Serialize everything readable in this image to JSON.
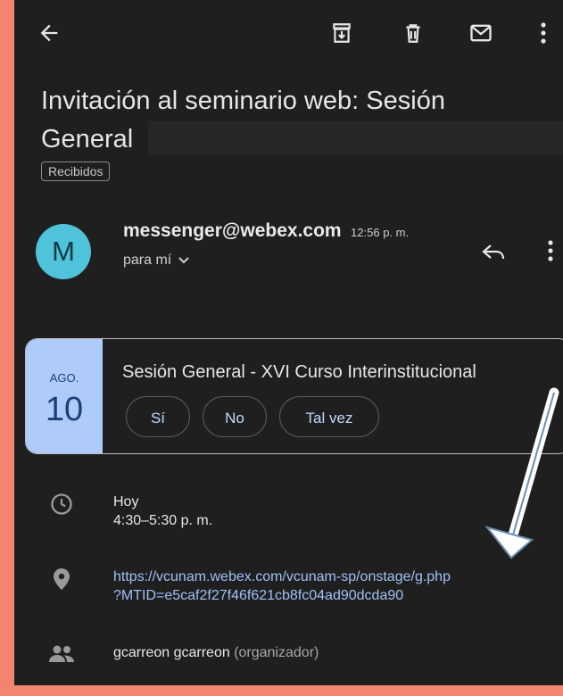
{
  "toolbar": {
    "back_icon": "arrow-left-icon",
    "archive_icon": "archive-icon",
    "delete_icon": "trash-icon",
    "unread_icon": "envelope-icon",
    "more_icon": "more-vertical-icon"
  },
  "email": {
    "subject_line1": "Invitación al seminario web: Sesión",
    "subject_line2": "General",
    "label": "Recibidos",
    "sender": {
      "avatar_letter": "M",
      "email": "messenger@webex.com",
      "time": "12:56 p. m.",
      "recipient": "para mí"
    }
  },
  "event": {
    "month": "AGO.",
    "day": "10",
    "title": "Sesión General - XVI Curso Interinstitucional",
    "rsvp": [
      "Sí",
      "No",
      "Tal vez"
    ],
    "when_label": "Hoy",
    "when_time": "4:30–5:30 p. m.",
    "location_line1": "https://vcunam.webex.com/vcunam-sp/onstage/g.php",
    "location_line2": "?MTID=e5caf2f27f46f621cb8fc04ad90dcda90",
    "organizer_name": "gcarreon gcarreon",
    "organizer_role": "(organizador)"
  },
  "colors": {
    "background": "#f4846f",
    "screen": "#1f1f1f",
    "avatar": "#4fc3d9",
    "date_block": "#aecbfa",
    "link": "#9ec1f5",
    "annotation_arrow": "#ffffff"
  }
}
